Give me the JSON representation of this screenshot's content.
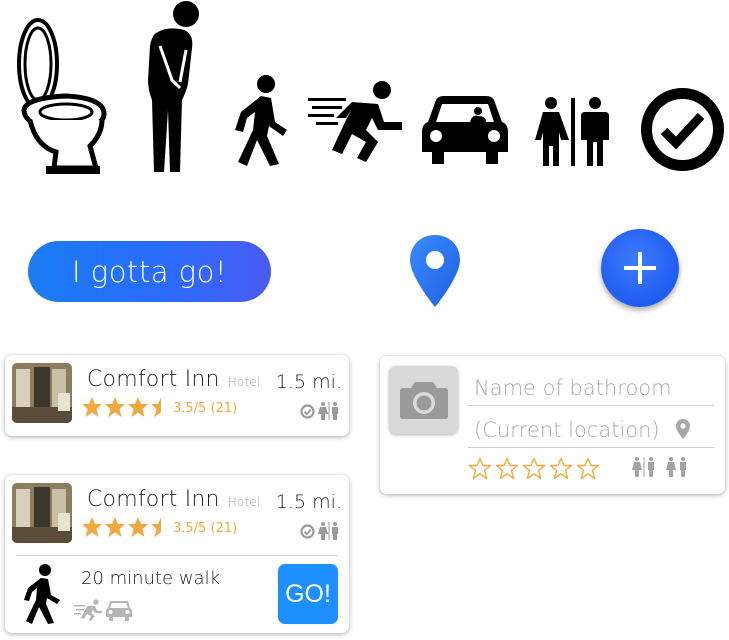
{
  "actions": {
    "gotta_go_label": "I gotta go!",
    "go_label": "GO!"
  },
  "listings": [
    {
      "name": "Comfort Inn",
      "type": "Hotel",
      "distance": "1.5 mi.",
      "rating_text": "3.5/5 (21)",
      "rating": 3.5
    },
    {
      "name": "Comfort Inn",
      "type": "Hotel",
      "distance": "1.5 mi.",
      "rating_text": "3.5/5 (21)",
      "rating": 3.5,
      "walk_text": "20 minute walk"
    }
  ],
  "add_form": {
    "name_placeholder": "Name of bathroom",
    "location_placeholder": "(Current location)"
  },
  "colors": {
    "primary": "#1e8fff",
    "star": "#f0a93e",
    "muted_icon": "#a9a9a9"
  }
}
